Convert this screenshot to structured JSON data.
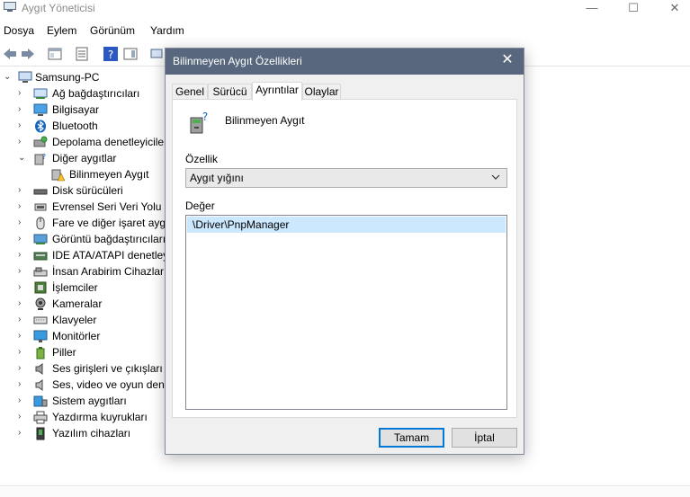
{
  "window": {
    "title": "Aygıt Yöneticisi",
    "minimize": "—",
    "maximize": "☐",
    "close": "✕"
  },
  "menu": [
    "Dosya",
    "Eylem",
    "Görünüm",
    "Yardım"
  ],
  "tree": {
    "root": "Samsung-PC",
    "items": [
      {
        "label": "Ağ bağdaştırıcıları",
        "icon": "network-adapter-icon"
      },
      {
        "label": "Bilgisayar",
        "icon": "computer-icon"
      },
      {
        "label": "Bluetooth",
        "icon": "bluetooth-icon"
      },
      {
        "label": "Depolama denetleyicileri",
        "icon": "storage-controller-icon"
      },
      {
        "label": "Diğer aygıtlar",
        "icon": "other-devices-icon",
        "expanded": true
      },
      {
        "label": "Bilinmeyen Aygıt",
        "icon": "unknown-device-warning-icon",
        "child": true
      },
      {
        "label": "Disk sürücüleri",
        "icon": "disk-drive-icon"
      },
      {
        "label": "Evrensel Seri Veri Yolu denetleyicileri",
        "icon": "usb-icon"
      },
      {
        "label": "Fare ve diğer işaret aygıtları",
        "icon": "mouse-icon"
      },
      {
        "label": "Görüntü bağdaştırıcıları",
        "icon": "display-adapter-icon"
      },
      {
        "label": "IDE ATA/ATAPI denetleyicileri",
        "icon": "ide-controller-icon"
      },
      {
        "label": "İnsan Arabirim Cihazları",
        "icon": "hid-icon"
      },
      {
        "label": "İşlemciler",
        "icon": "processor-icon"
      },
      {
        "label": "Kameralar",
        "icon": "camera-icon"
      },
      {
        "label": "Klavyeler",
        "icon": "keyboard-icon"
      },
      {
        "label": "Monitörler",
        "icon": "monitor-icon"
      },
      {
        "label": "Piller",
        "icon": "battery-icon"
      },
      {
        "label": "Ses girişleri ve çıkışları",
        "icon": "speaker-icon"
      },
      {
        "label": "Ses, video ve oyun denetleyicileri",
        "icon": "sound-controller-icon"
      },
      {
        "label": "Sistem aygıtları",
        "icon": "system-device-icon"
      },
      {
        "label": "Yazdırma kuyrukları",
        "icon": "printer-icon"
      },
      {
        "label": "Yazılım cihazları",
        "icon": "software-device-icon"
      }
    ]
  },
  "dialog": {
    "title": "Bilinmeyen Aygıt Özellikleri",
    "close": "✕",
    "tabs": [
      "Genel",
      "Sürücü",
      "Ayrıntılar",
      "Olaylar"
    ],
    "active_tab": "Ayrıntılar",
    "device_name": "Bilinmeyen Aygıt",
    "property_label": "Özellik",
    "property_value": "Aygıt yığını",
    "value_label": "Değer",
    "values": [
      "\\Driver\\PnpManager"
    ],
    "ok_label": "Tamam",
    "cancel_label": "İptal"
  },
  "colors": {
    "dialog_title_bg": "#58677d",
    "selection": "#cce8ff",
    "default_button_border": "#0078d7"
  }
}
